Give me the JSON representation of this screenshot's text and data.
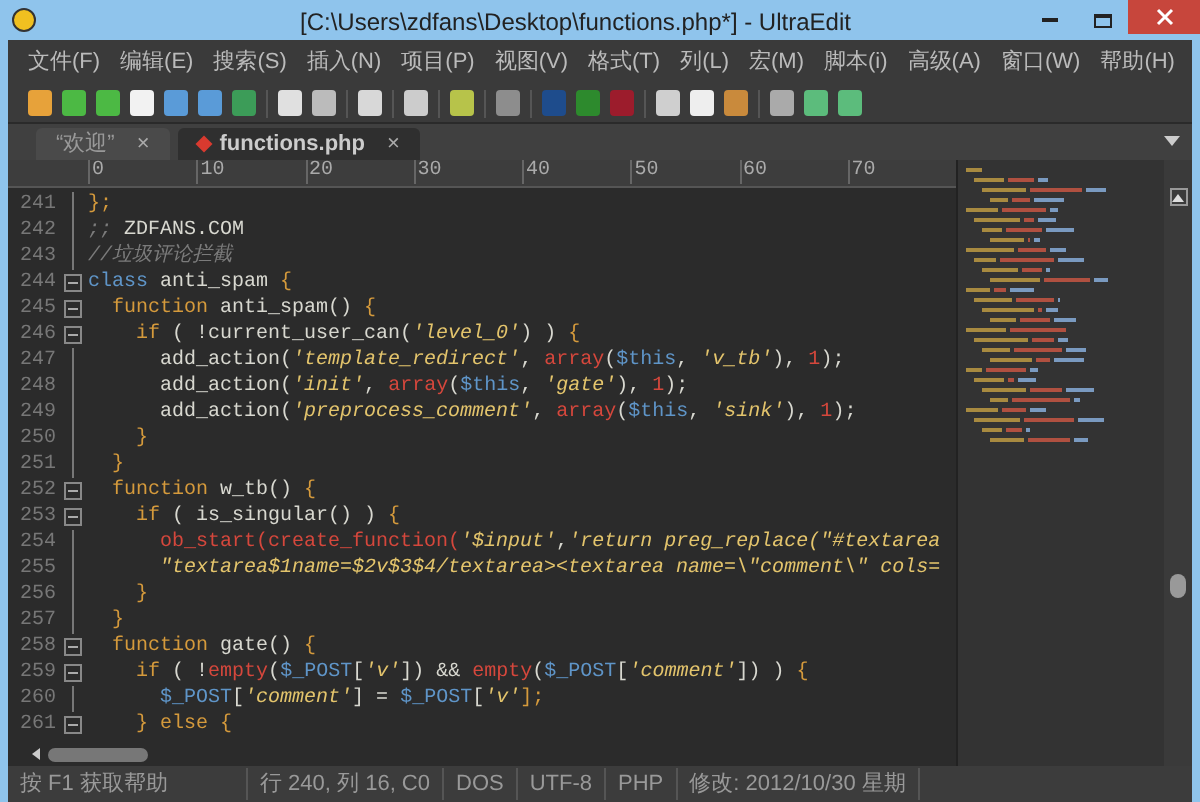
{
  "window": {
    "title": "[C:\\Users\\zdfans\\Desktop\\functions.php*] - UltraEdit"
  },
  "menu": [
    "文件(F)",
    "编辑(E)",
    "搜索(S)",
    "插入(N)",
    "项目(P)",
    "视图(V)",
    "格式(T)",
    "列(L)",
    "宏(M)",
    "脚本(i)",
    "高级(A)",
    "窗口(W)",
    "帮助(H)"
  ],
  "tabs": [
    {
      "label": "“欢迎”",
      "selected": false,
      "modified": false,
      "close": "×"
    },
    {
      "label": "functions.php",
      "selected": true,
      "modified": true,
      "close": "×"
    }
  ],
  "ruler": [
    "0",
    "10",
    "20",
    "30",
    "40",
    "50",
    "60",
    "70"
  ],
  "code": [
    {
      "n": "241",
      "fold": false,
      "tokens": [
        {
          "t": "};",
          "kind": "keyword"
        }
      ]
    },
    {
      "n": "242",
      "fold": false,
      "tokens": [
        {
          "t": ";; ",
          "kind": "comment"
        },
        {
          "t": "ZDFANS.COM",
          "kind": "plain"
        }
      ]
    },
    {
      "n": "243",
      "fold": false,
      "tokens": [
        {
          "t": "//垃圾评论拦截",
          "kind": "comment"
        }
      ]
    },
    {
      "n": "244",
      "fold": true,
      "tokens": [
        {
          "t": "class",
          "kind": "var"
        },
        {
          "t": " anti_spam ",
          "kind": "plain"
        },
        {
          "t": "{",
          "kind": "keyword"
        }
      ]
    },
    {
      "n": "245",
      "fold": true,
      "tokens": [
        {
          "t": "  function",
          "kind": "keyword"
        },
        {
          "t": " anti_spam() ",
          "kind": "plain"
        },
        {
          "t": "{",
          "kind": "keyword"
        }
      ]
    },
    {
      "n": "246",
      "fold": true,
      "tokens": [
        {
          "t": "    if",
          "kind": "keyword"
        },
        {
          "t": " ( !current_user_can(",
          "kind": "plain"
        },
        {
          "t": "'level_0'",
          "kind": "string"
        },
        {
          "t": ") ) ",
          "kind": "plain"
        },
        {
          "t": "{",
          "kind": "keyword"
        }
      ]
    },
    {
      "n": "247",
      "fold": false,
      "tokens": [
        {
          "t": "      add_action(",
          "kind": "plain"
        },
        {
          "t": "'template_redirect'",
          "kind": "string"
        },
        {
          "t": ", ",
          "kind": "plain"
        },
        {
          "t": "array",
          "kind": "func"
        },
        {
          "t": "(",
          "kind": "plain"
        },
        {
          "t": "$this",
          "kind": "var"
        },
        {
          "t": ", ",
          "kind": "plain"
        },
        {
          "t": "'v_tb'",
          "kind": "string"
        },
        {
          "t": "), ",
          "kind": "plain"
        },
        {
          "t": "1",
          "kind": "func"
        },
        {
          "t": ");",
          "kind": "plain"
        }
      ]
    },
    {
      "n": "248",
      "fold": false,
      "tokens": [
        {
          "t": "      add_action(",
          "kind": "plain"
        },
        {
          "t": "'init'",
          "kind": "string"
        },
        {
          "t": ", ",
          "kind": "plain"
        },
        {
          "t": "array",
          "kind": "func"
        },
        {
          "t": "(",
          "kind": "plain"
        },
        {
          "t": "$this",
          "kind": "var"
        },
        {
          "t": ", ",
          "kind": "plain"
        },
        {
          "t": "'gate'",
          "kind": "string"
        },
        {
          "t": "), ",
          "kind": "plain"
        },
        {
          "t": "1",
          "kind": "func"
        },
        {
          "t": ");",
          "kind": "plain"
        }
      ]
    },
    {
      "n": "249",
      "fold": false,
      "tokens": [
        {
          "t": "      add_action(",
          "kind": "plain"
        },
        {
          "t": "'preprocess_comment'",
          "kind": "string"
        },
        {
          "t": ", ",
          "kind": "plain"
        },
        {
          "t": "array",
          "kind": "func"
        },
        {
          "t": "(",
          "kind": "plain"
        },
        {
          "t": "$this",
          "kind": "var"
        },
        {
          "t": ", ",
          "kind": "plain"
        },
        {
          "t": "'sink'",
          "kind": "string"
        },
        {
          "t": "), ",
          "kind": "plain"
        },
        {
          "t": "1",
          "kind": "func"
        },
        {
          "t": ");",
          "kind": "plain"
        }
      ]
    },
    {
      "n": "250",
      "fold": false,
      "tokens": [
        {
          "t": "    }",
          "kind": "keyword"
        }
      ]
    },
    {
      "n": "251",
      "fold": false,
      "tokens": [
        {
          "t": "  }",
          "kind": "keyword"
        }
      ]
    },
    {
      "n": "252",
      "fold": true,
      "tokens": [
        {
          "t": "  function",
          "kind": "keyword"
        },
        {
          "t": " w_tb() ",
          "kind": "plain"
        },
        {
          "t": "{",
          "kind": "keyword"
        }
      ]
    },
    {
      "n": "253",
      "fold": true,
      "tokens": [
        {
          "t": "    if",
          "kind": "keyword"
        },
        {
          "t": " ( is_singular() ) ",
          "kind": "plain"
        },
        {
          "t": "{",
          "kind": "keyword"
        }
      ]
    },
    {
      "n": "254",
      "fold": false,
      "tokens": [
        {
          "t": "      ob_start(create_function(",
          "kind": "func"
        },
        {
          "t": "'$input'",
          "kind": "string"
        },
        {
          "t": ",",
          "kind": "plain"
        },
        {
          "t": "'return preg_replace(\"#textarea",
          "kind": "string"
        }
      ]
    },
    {
      "n": "255",
      "fold": false,
      "tokens": [
        {
          "t": "      \"textarea$1name=$2v$3$4/textarea><textarea name=\\\"comment\\\" cols=",
          "kind": "string"
        }
      ]
    },
    {
      "n": "256",
      "fold": false,
      "tokens": [
        {
          "t": "    }",
          "kind": "keyword"
        }
      ]
    },
    {
      "n": "257",
      "fold": false,
      "tokens": [
        {
          "t": "  }",
          "kind": "keyword"
        }
      ]
    },
    {
      "n": "258",
      "fold": true,
      "tokens": [
        {
          "t": "  function",
          "kind": "keyword"
        },
        {
          "t": " gate() ",
          "kind": "plain"
        },
        {
          "t": "{",
          "kind": "keyword"
        }
      ]
    },
    {
      "n": "259",
      "fold": true,
      "tokens": [
        {
          "t": "    if",
          "kind": "keyword"
        },
        {
          "t": " ( !",
          "kind": "plain"
        },
        {
          "t": "empty",
          "kind": "func"
        },
        {
          "t": "(",
          "kind": "plain"
        },
        {
          "t": "$_POST",
          "kind": "var"
        },
        {
          "t": "[",
          "kind": "plain"
        },
        {
          "t": "'v'",
          "kind": "string"
        },
        {
          "t": "]) && ",
          "kind": "plain"
        },
        {
          "t": "empty",
          "kind": "func"
        },
        {
          "t": "(",
          "kind": "plain"
        },
        {
          "t": "$_POST",
          "kind": "var"
        },
        {
          "t": "[",
          "kind": "plain"
        },
        {
          "t": "'comment'",
          "kind": "string"
        },
        {
          "t": "]) ) ",
          "kind": "plain"
        },
        {
          "t": "{",
          "kind": "keyword"
        }
      ]
    },
    {
      "n": "260",
      "fold": false,
      "tokens": [
        {
          "t": "      $_POST",
          "kind": "var"
        },
        {
          "t": "[",
          "kind": "plain"
        },
        {
          "t": "'comment'",
          "kind": "string"
        },
        {
          "t": "] = ",
          "kind": "plain"
        },
        {
          "t": "$_POST",
          "kind": "var"
        },
        {
          "t": "[",
          "kind": "plain"
        },
        {
          "t": "'v'",
          "kind": "string"
        },
        {
          "t": "];",
          "kind": "keyword"
        }
      ]
    },
    {
      "n": "261",
      "fold": true,
      "tokens": [
        {
          "t": "    } else {",
          "kind": "keyword"
        }
      ]
    }
  ],
  "status_bar": [
    "按 F1 获取帮助",
    "行 240, 列 16, C0",
    "DOS",
    "UTF-8",
    "PHP",
    "修改: 2012/10/30 星期"
  ]
}
